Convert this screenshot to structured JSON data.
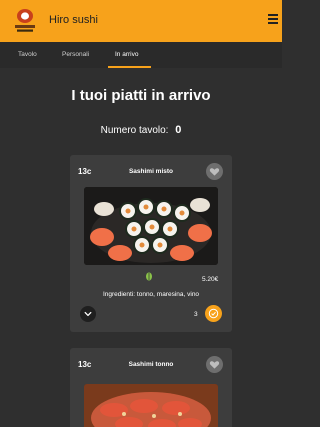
{
  "header": {
    "brand": "Hiro sushi",
    "logo_icon": "hiro-logo-icon",
    "menu_icon": "hamburger-menu-icon"
  },
  "tabs": [
    {
      "label": "Tavolo",
      "active": false
    },
    {
      "label": "Personali",
      "active": false
    },
    {
      "label": "In arrivo",
      "active": true
    }
  ],
  "main": {
    "title": "I tuoi piatti in arrivo",
    "table_label": "Numero tavolo:",
    "table_number": "0"
  },
  "dishes": [
    {
      "code": "13c",
      "name": "Sashimi misto",
      "price": "5.20€",
      "ingredients": "Ingredienti: tonno, maresina, vino",
      "quantity": "3",
      "favorite_icon": "heart-icon",
      "diet_icon": "veggie-leaf-icon"
    },
    {
      "code": "13c",
      "name": "Sashimi tonno",
      "favorite_icon": "heart-icon"
    }
  ],
  "colors": {
    "accent": "#f7a21b",
    "background": "#2f2f2f",
    "card": "#3d3d3d",
    "tabbar": "#2a2a2a"
  }
}
